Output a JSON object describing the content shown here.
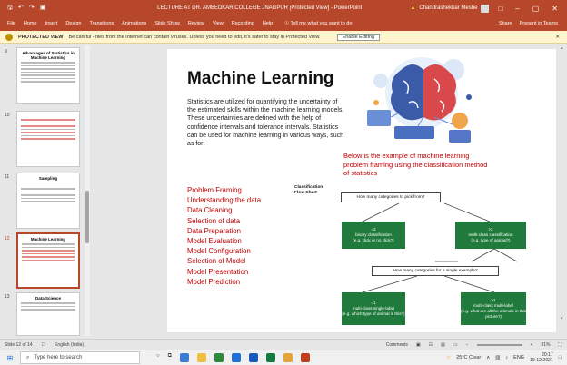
{
  "window": {
    "title": "LECTURE AT DR. AMBEDKAR COLLEGE JNAGPUR [Protected View] - PowerPoint",
    "user_name": "Chandrashekhar Meshe",
    "quick_access": [
      "save",
      "undo",
      "redo",
      "present"
    ]
  },
  "ribbon": {
    "tabs": [
      "File",
      "Home",
      "Insert",
      "Design",
      "Transitions",
      "Animations",
      "Slide Show",
      "Review",
      "View",
      "Recording",
      "Help"
    ],
    "search_placeholder": "Tell me what you want to do",
    "share_label": "Share",
    "present_label": "Present in Teams"
  },
  "protected_view": {
    "label": "PROTECTED VIEW",
    "message": "Be careful - files from the Internet can contain viruses. Unless you need to edit, it's safer to stay in Protected View.",
    "button": "Enable Editing"
  },
  "thumbnails": [
    {
      "num": "9",
      "title": "Advantages of Statistics in Machine Learning",
      "selected": false
    },
    {
      "num": "10",
      "title": "",
      "selected": false
    },
    {
      "num": "11",
      "title": "Sampling",
      "selected": false
    },
    {
      "num": "12",
      "title": "Machine Learning",
      "selected": true
    },
    {
      "num": "13",
      "title": "Data Science",
      "selected": false
    }
  ],
  "slide": {
    "heading": "Machine Learning",
    "paragraph": "Statistics are utilized for quantifying the uncertainty of the estimated skills within the machine learning models. These uncertainties are defined with the help of confidence intervals and tolerance intervals. Statistics can be used for machine learning in various ways, such as for:",
    "list": [
      "Problem Framing",
      "Understanding the data",
      "Data Cleaning",
      "Selection of data",
      "Data Preparation",
      "Model Evaluation",
      "Model Configuration",
      "Selection of Model",
      "Model Presentation",
      "Model Prediction"
    ],
    "note": "Below is the example of machine learning problem framing using the classification method of statistics",
    "flowchart": {
      "caption": "Classification Flow Chart",
      "q1": "How many categories to pick from?",
      "left1_title": "=2",
      "left1_sub": "binary classification",
      "left1_eg": "(e.g. click or no click?)",
      "right1_title": ">2",
      "right1_sub": "multi-class classification",
      "right1_eg": "(e.g. type of animal?)",
      "q2": "How many categories for a single example?",
      "left2_title": "=1",
      "left2_sub": "multi-class single-label",
      "left2_eg": "(e.g. which type of animal is this?)",
      "right2_title": ">1",
      "right2_sub": "multi-class multi-label",
      "right2_eg": "(e.g. what are all the animals in this picture?)"
    }
  },
  "statusbar": {
    "slide_info": "Slide 12 of 14",
    "language": "English (India)",
    "comments": "Comments",
    "zoom": "81%"
  },
  "taskbar": {
    "search_placeholder": "Type here to search",
    "weather": "25°C  Clear",
    "lang": "ENG",
    "time": "20:17",
    "date": "19-12-2021"
  },
  "colors": {
    "accent": "#b7472a",
    "list_red": "#c00000",
    "flow_green": "#1f7a3b"
  }
}
